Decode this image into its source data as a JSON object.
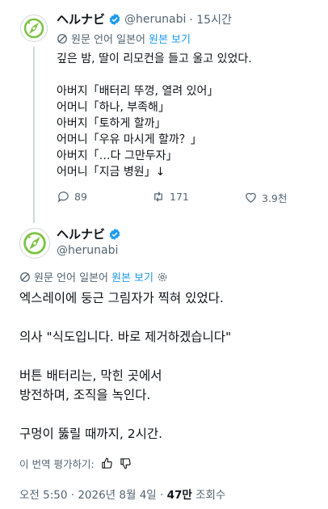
{
  "tweet1": {
    "display_name": "ヘルナビ",
    "handle": "@herunabi",
    "time": "· 15시간",
    "translation": {
      "text": "원문 언어 일본어",
      "link": "원본 보기"
    },
    "lines": [
      "깊은 밤, 딸이 리모컨을 들고 울고 있었다.",
      "",
      "아버지「배터리 뚜껑, 열려 있어」",
      "어머니「하나, 부족해」",
      "아버지「토하게 할까」",
      "어머니「우유 마시게 할까？」",
      "아버지「…다 그만두자」",
      "어머니「지금 병원」↓"
    ],
    "replies": "89",
    "retweets": "171",
    "likes": "3.9천"
  },
  "tweet2": {
    "display_name": "ヘルナビ",
    "handle": "@herunabi",
    "translation": {
      "text": "원문 언어 일본어",
      "link": "원본 보기"
    },
    "lines": [
      "엑스레이에 둥근 그림자가 찍혀 있었다.",
      "",
      "의사 \"식도입니다. 바로 제거하겠습니다\"",
      "",
      "버튼 배터리는, 막힌 곳에서",
      "방전하며, 조직을 녹인다.",
      "",
      "구멍이 뚫릴 때까지, 2시간."
    ],
    "rate_translation": "이 번역 평가하기:",
    "timestamp": "오전 5:50 · 2026년 8월 4일 · ",
    "views_count": "47만",
    "views_label": " 조회수"
  },
  "colors": {
    "accent": "#1d9bf0",
    "text": "#0f1419",
    "muted": "#536471",
    "logo_green": "#7cc243"
  }
}
